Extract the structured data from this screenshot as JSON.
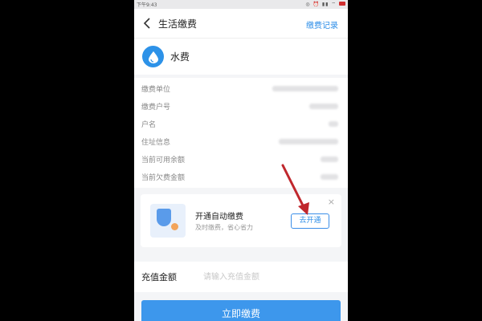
{
  "statusbar": {
    "time": "下午9:43",
    "icons": "◎ ⏰ ▮▮ ⌔"
  },
  "nav": {
    "title": "生活缴费",
    "record": "缴费记录"
  },
  "header": {
    "name": "水费"
  },
  "info_rows": [
    {
      "label": "缴费单位"
    },
    {
      "label": "缴费户号"
    },
    {
      "label": "户名"
    },
    {
      "label": "住址信息"
    },
    {
      "label": "当前可用余额"
    },
    {
      "label": "当前欠费金额"
    }
  ],
  "auto_pay": {
    "title": "开通自动缴费",
    "subtitle": "及时缴费，省心省力",
    "button": "去开通",
    "close": "×"
  },
  "amount": {
    "label": "充值金额",
    "placeholder": "请输入充值金额",
    "value": ""
  },
  "pay_button": "立即缴费",
  "colors": {
    "accent": "#2d8ee8",
    "button": "#3d97ec",
    "arrow": "#c0272d"
  }
}
